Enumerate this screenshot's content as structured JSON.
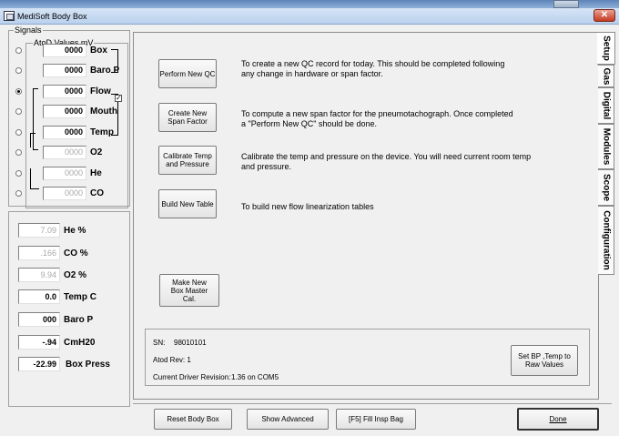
{
  "window": {
    "title": "MediSoft Body Box",
    "close_symbol": "✕"
  },
  "signals": {
    "group_label": "Signals",
    "atod_label": "AtoD Values mV",
    "rows": [
      {
        "value": "0000",
        "label": "Box",
        "dim": false,
        "selected": false
      },
      {
        "value": "0000",
        "label": "Baro P",
        "dim": false,
        "selected": false
      },
      {
        "value": "0000",
        "label": "Flow",
        "dim": false,
        "selected": true
      },
      {
        "value": "0000",
        "label": "Mouth",
        "dim": false,
        "selected": false
      },
      {
        "value": "0000",
        "label": "Temp",
        "dim": false,
        "selected": false
      },
      {
        "value": "0000",
        "label": "O2",
        "dim": true,
        "selected": false
      },
      {
        "value": "0000",
        "label": "He",
        "dim": true,
        "selected": false
      },
      {
        "value": "0000",
        "label": "CO",
        "dim": true,
        "selected": false
      }
    ]
  },
  "calculated": [
    {
      "value": "7.09",
      "label": "He %",
      "dim": true
    },
    {
      "value": ".166",
      "label": "CO %",
      "dim": true
    },
    {
      "value": "9.94",
      "label": "O2 %",
      "dim": true
    },
    {
      "value": "0.0",
      "label": "Temp C",
      "dim": false
    },
    {
      "value": "000",
      "label": "Baro P",
      "dim": false
    },
    {
      "value": "-.94",
      "label": "CmH20",
      "dim": false
    },
    {
      "value": "-22.99",
      "label": "Box Press",
      "dim": false
    }
  ],
  "setup": {
    "actions": [
      {
        "button": "Perform New QC",
        "description": "To create a new QC record for today. This should be completed following any change in hardware or span factor."
      },
      {
        "button": "Create New Span Factor",
        "description": "To compute a new span factor for the pneumotachograph. Once completed a \"Perform New QC\" should be done."
      },
      {
        "button": "Calibrate Temp and Pressure",
        "description": "Calibrate the temp and pressure on the device.  You will need current room temp and pressure."
      },
      {
        "button": "Build New Table",
        "description": "To build new flow linearization tables"
      }
    ],
    "master_button": "Make New Box Master Cal.",
    "info": {
      "sn_label": "SN:",
      "sn_value": "98010101",
      "atod_rev": "Atod Rev: 1",
      "driver_label": "Current Driver Revision:",
      "driver_value": "1.36 on COM5",
      "set_bp_button": "Set BP ,Temp to Raw Values"
    }
  },
  "tabs": [
    "Setup",
    "Gas",
    "Digital",
    "Modules",
    "Scope",
    "Configuration"
  ],
  "bottom_buttons": {
    "reset": "Reset Body Box",
    "advanced": "Show Advanced",
    "fill": "[F5]  Fill Insp Bag",
    "done": "Done"
  }
}
